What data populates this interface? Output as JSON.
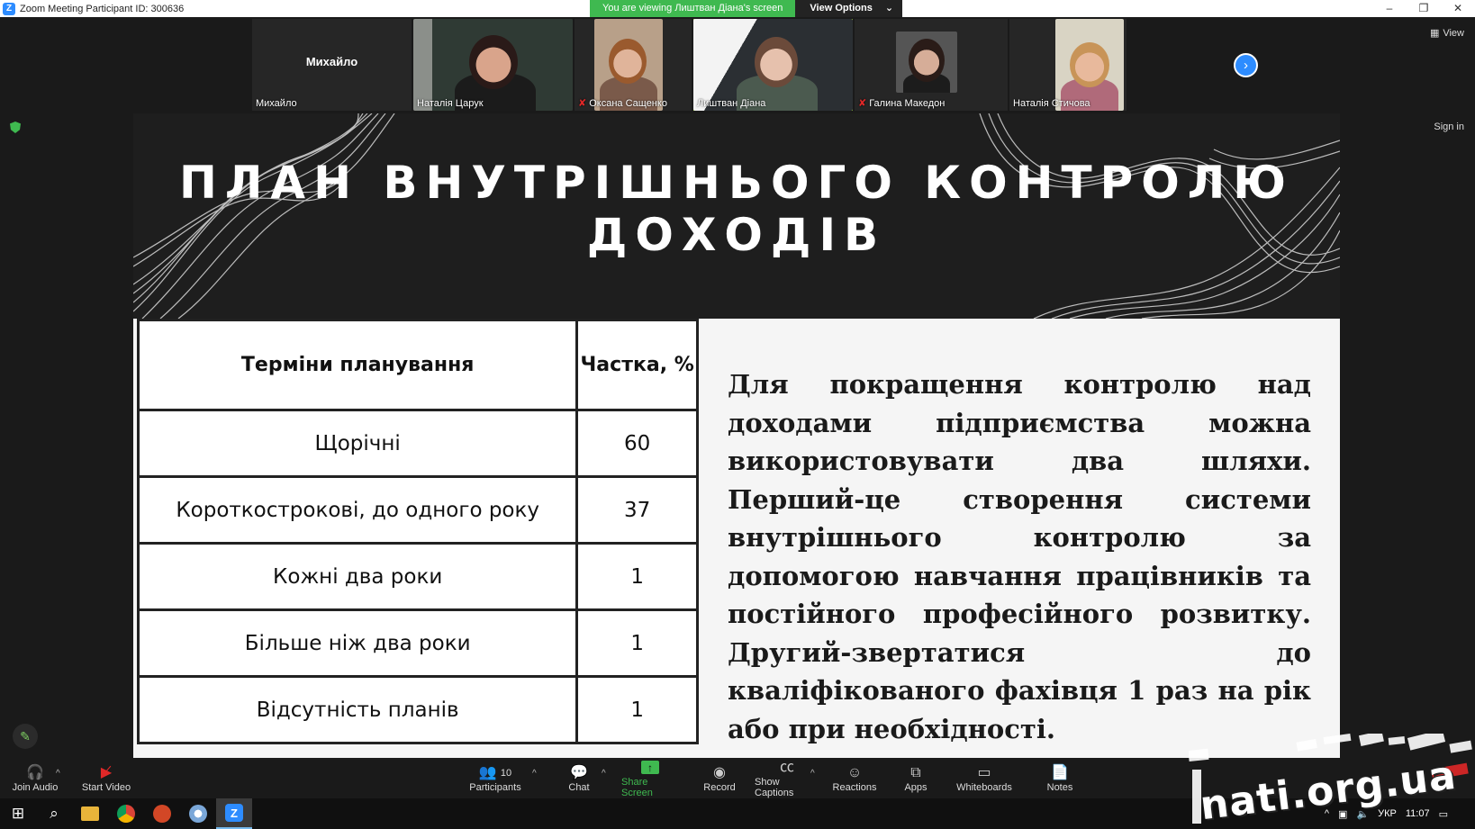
{
  "window": {
    "title": "Zoom Meeting Participant ID: 300636",
    "viewing_banner": "You are viewing Лиштван Діана's screen",
    "view_options": "View Options",
    "view_label": "View",
    "sign_in": "Sign in"
  },
  "participants": [
    {
      "name": "Михайло",
      "video": false,
      "muted": false
    },
    {
      "name": "Наталія Царук",
      "video": true,
      "muted": false
    },
    {
      "name": "Оксана Сащенко",
      "video": true,
      "muted": true
    },
    {
      "name": "Лиштван Діана",
      "video": true,
      "muted": false,
      "active": true
    },
    {
      "name": "Галина Македон",
      "video": true,
      "muted": true
    },
    {
      "name": "Наталія Стичова",
      "video": true,
      "muted": false
    }
  ],
  "slide": {
    "title": "ПЛАН ВНУТРІШНЬОГО КОНТРОЛЮ ДОХОДІВ",
    "table": {
      "headers": [
        "Терміни планування",
        "Частка, %"
      ],
      "rows": [
        [
          "Щорічні",
          "60"
        ],
        [
          "Короткострокові, до одного року",
          "37"
        ],
        [
          "Кожні два роки",
          "1"
        ],
        [
          "Більше ніж два роки",
          "1"
        ],
        [
          "Відсутність планів",
          "1"
        ]
      ]
    },
    "text": "Для покращення контролю над доходами підприємства можна використовувати два шляхи. Перший-це створення системи внутрішнього контролю за допомогою навчання працівників та постійного професійного розвитку. Другий-звертатися до кваліфікованого фахівця 1 раз на рік або при необхідності."
  },
  "toolbar": {
    "join_audio": "Join Audio",
    "start_video": "Start Video",
    "participants": "Participants",
    "participants_count": "10",
    "chat": "Chat",
    "share_screen": "Share Screen",
    "record": "Record",
    "show_captions": "Show Captions",
    "reactions": "Reactions",
    "apps": "Apps",
    "whiteboards": "Whiteboards",
    "notes": "Notes"
  },
  "taskbar": {
    "language": "УКР",
    "time": "11:07"
  },
  "watermark": "nati.org.ua",
  "colors": {
    "zoom_blue": "#2d8cff",
    "green": "#3fb950",
    "mute_red": "#e02828"
  }
}
